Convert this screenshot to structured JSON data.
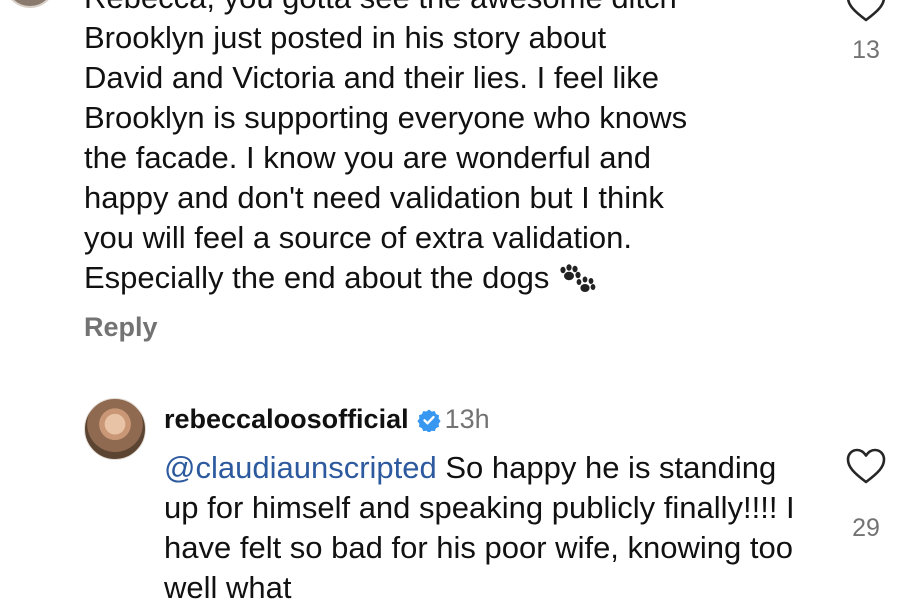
{
  "comment": {
    "text": "Rebecca, you gotta see the awesome ditch\nBrooklyn just posted in his story about\nDavid and Victoria and their lies. I feel like\nBrooklyn is supporting everyone who knows\nthe facade. I know you are wonderful and\nhappy and don't need validation but I think\nyou will feel a source of extra validation.\nEspecially the end about the dogs",
    "emoji": "paw-prints-icon",
    "likes": "13",
    "reply_label": "Reply"
  },
  "reply": {
    "username": "rebeccaloosofficial",
    "verified": true,
    "timestamp": "13h",
    "mention": "@claudiaunscripted",
    "text": "So happy he is standing up for himself and speaking publicly finally!!!! I have felt so bad for his poor wife, knowing too well what",
    "likes": "29"
  },
  "colors": {
    "text": "#111111",
    "secondary": "#737373",
    "mention": "#2d5a9e",
    "verified_badge": "#3897f0"
  }
}
